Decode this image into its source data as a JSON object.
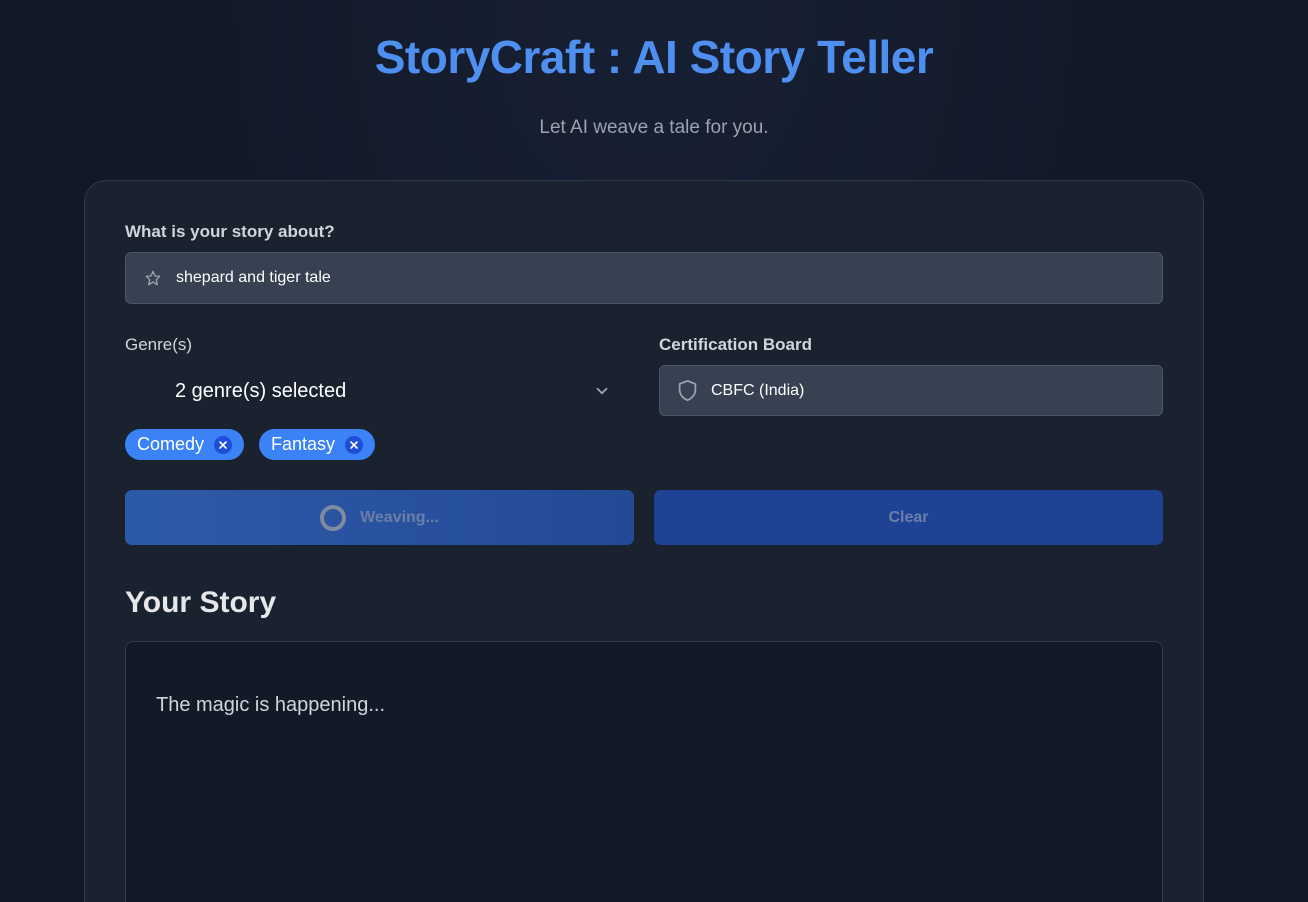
{
  "header": {
    "title": "StoryCraft : AI Story Teller",
    "subtitle": "Let AI weave a tale for you."
  },
  "form": {
    "topic_label": "What is your story about?",
    "topic_value": "shepard and tiger tale",
    "genre_label": "Genre(s)",
    "genre_summary": "2 genre(s) selected",
    "genres_selected": [
      {
        "label": "Comedy"
      },
      {
        "label": "Fantasy"
      }
    ],
    "certification_label": "Certification Board",
    "certification_value": "CBFC (India)"
  },
  "actions": {
    "generate_label": "Weaving...",
    "clear_label": "Clear"
  },
  "story": {
    "title": "Your Story",
    "status_text": "The magic is happening..."
  },
  "colors": {
    "accent": "#4f8ff0",
    "chip": "#3b82f6",
    "background": "#111827",
    "card": "#1a2230"
  },
  "icons": {
    "topic": "star-icon",
    "genre_dropdown": "chevron-down-icon",
    "certification": "shield-icon",
    "chip_remove": "close-icon",
    "loading": "spinner-icon"
  }
}
